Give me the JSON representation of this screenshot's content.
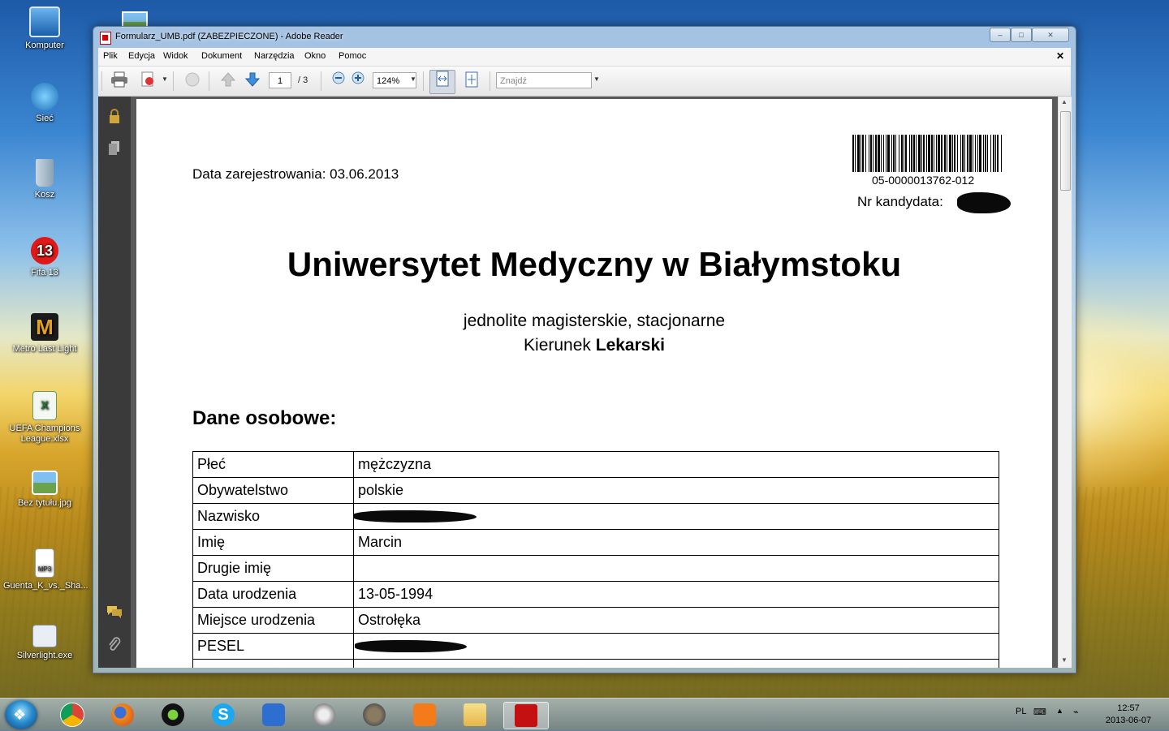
{
  "desktop": {
    "icons": [
      {
        "label": "Komputer",
        "icon": "computer-icon"
      },
      {
        "label": "Sieć",
        "icon": "network-icon"
      },
      {
        "label": "Kosz",
        "icon": "recycle-bin-icon"
      },
      {
        "label": "Fifa 13",
        "icon": "fifa-icon"
      },
      {
        "label": "Metro Last Light",
        "icon": "metro-icon"
      },
      {
        "label": "UEFA Champions League.xlsx",
        "icon": "excel-file-icon"
      },
      {
        "label": "Bez tytułu.jpg",
        "icon": "image-file-icon"
      },
      {
        "label": "Guenta_K_vs._Sha...",
        "icon": "mp3-file-icon"
      },
      {
        "label": "Silverlight.exe",
        "icon": "exe-file-icon"
      }
    ]
  },
  "window": {
    "title": "Formularz_UMB.pdf (ZABEZPIECZONE) - Adobe Reader",
    "controls": {
      "minimize": "–",
      "maximize": "□",
      "close": "✕"
    }
  },
  "menu": {
    "items": [
      "Plik",
      "Edycja",
      "Widok",
      "Dokument",
      "Narzędzia",
      "Okno",
      "Pomoc"
    ],
    "doc_close": "✕"
  },
  "toolbar": {
    "page_current": "1",
    "page_total": "/ 3",
    "zoom": "124%",
    "find_placeholder": "Znajdź"
  },
  "document": {
    "registration": "Data zarejestrowania: 03.06.2013",
    "barcode_number": "05-0000013762-012",
    "candidate_label": "Nr kandydata:",
    "university": "Uniwersytet Medyczny w Białymstoku",
    "study_mode": "jednolite magisterskie, stacjonarne",
    "field_prefix": "Kierunek",
    "field_name": "Lekarski",
    "section_title": "Dane osobowe:",
    "rows": [
      {
        "key": "Płeć",
        "value": "mężczyzna"
      },
      {
        "key": "Obywatelstwo",
        "value": "polskie"
      },
      {
        "key": "Nazwisko",
        "value": ""
      },
      {
        "key": "Imię",
        "value": "Marcin"
      },
      {
        "key": "Drugie imię",
        "value": ""
      },
      {
        "key": "Data urodzenia",
        "value": "13-05-1994"
      },
      {
        "key": "Miejsce urodzenia",
        "value": "Ostrołęka"
      },
      {
        "key": "PESEL",
        "value": ""
      },
      {
        "key": "",
        "value": ""
      }
    ]
  },
  "taskbar": {
    "language": "PL",
    "time": "12:57",
    "date": "2013-06-07",
    "apps": [
      "chrome-icon",
      "firefox-icon",
      "razer-icon",
      "skype-icon",
      "malwarebytes-icon",
      "hexagon-app-icon",
      "gimp-icon",
      "xampp-icon",
      "file-explorer-icon",
      "adobe-reader-icon"
    ]
  }
}
